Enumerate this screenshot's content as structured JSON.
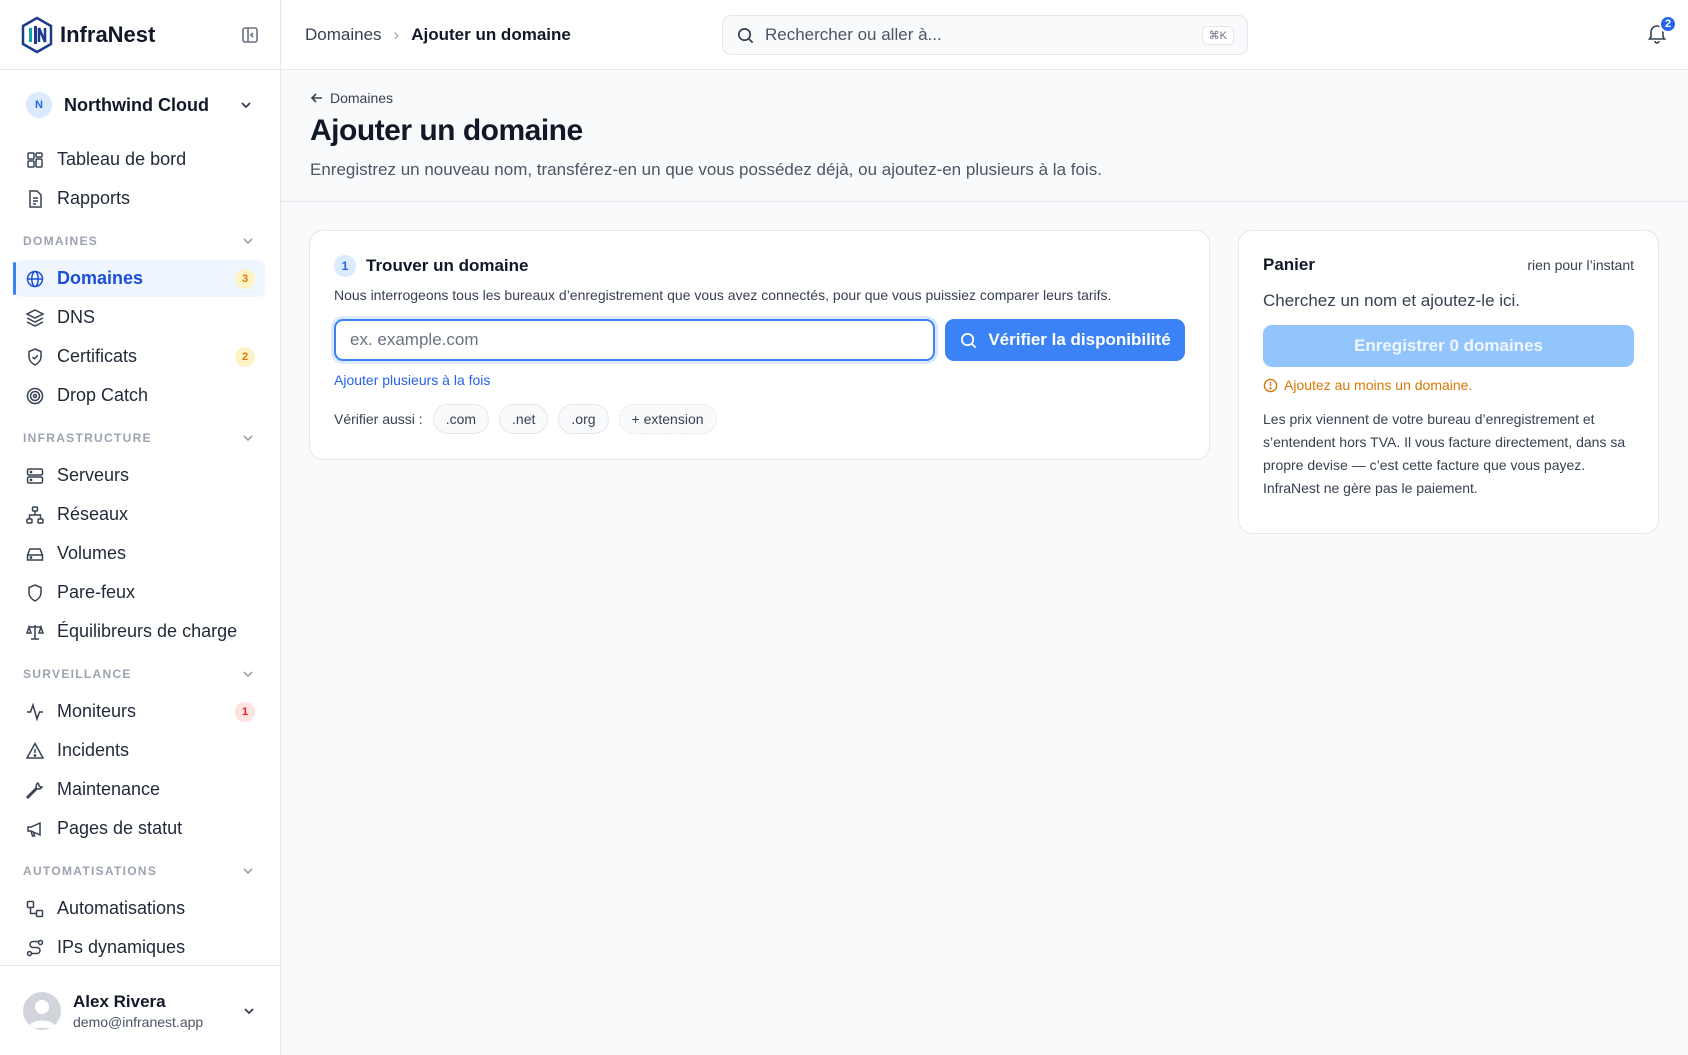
{
  "app": {
    "name": "InfraNest"
  },
  "org": {
    "initial": "N",
    "name": "Northwind Cloud"
  },
  "nav": {
    "top": [
      {
        "label": "Tableau de bord",
        "icon": "dashboard-icon"
      },
      {
        "label": "Rapports",
        "icon": "document-icon"
      }
    ],
    "sections": [
      {
        "title": "DOMAINES",
        "items": [
          {
            "label": "Domaines",
            "icon": "globe-icon",
            "badge": "3",
            "active": true
          },
          {
            "label": "DNS",
            "icon": "layers-icon"
          },
          {
            "label": "Certificats",
            "icon": "shield-check-icon",
            "badge": "2"
          },
          {
            "label": "Drop Catch",
            "icon": "target-icon"
          }
        ]
      },
      {
        "title": "INFRASTRUCTURE",
        "items": [
          {
            "label": "Serveurs",
            "icon": "server-icon"
          },
          {
            "label": "Réseaux",
            "icon": "network-icon"
          },
          {
            "label": "Volumes",
            "icon": "drive-icon"
          },
          {
            "label": "Pare-feux",
            "icon": "shield-icon"
          },
          {
            "label": "Équilibreurs de charge",
            "icon": "scale-icon"
          }
        ]
      },
      {
        "title": "SURVEILLANCE",
        "items": [
          {
            "label": "Moniteurs",
            "icon": "activity-icon",
            "badge": "1"
          },
          {
            "label": "Incidents",
            "icon": "alert-triangle-icon"
          },
          {
            "label": "Maintenance",
            "icon": "wrench-icon"
          },
          {
            "label": "Pages de statut",
            "icon": "megaphone-icon"
          }
        ]
      },
      {
        "title": "AUTOMATISATIONS",
        "items": [
          {
            "label": "Automatisations",
            "icon": "workflow-icon"
          },
          {
            "label": "IPs dynamiques",
            "icon": "route-icon"
          }
        ]
      }
    ]
  },
  "user": {
    "name": "Alex Rivera",
    "email": "demo@infranest.app"
  },
  "topbar": {
    "crumb_parent": "Domaines",
    "crumb_current": "Ajouter un domaine",
    "search_placeholder": "Rechercher ou aller à...",
    "search_shortcut": "⌘K",
    "notifications": "2"
  },
  "page": {
    "back_label": "Domaines",
    "title": "Ajouter un domaine",
    "description": "Enregistrez un nouveau nom, transférez-en un que vous possédez déjà, ou ajoutez-en plusieurs à la fois."
  },
  "find": {
    "step": "1",
    "title": "Trouver un domaine",
    "subtitle": "Nous interrogeons tous les bureaux d’enregistrement que vous avez connectés, pour que vous puissiez comparer leurs tarifs.",
    "input_placeholder": "ex. example.com",
    "check_button": "Vérifier la disponibilité",
    "bulk_link": "Ajouter plusieurs à la fois",
    "also_label": "Vérifier aussi :",
    "extensions": [
      ".com",
      ".net",
      ".org"
    ],
    "add_extension": "+ extension"
  },
  "cart": {
    "title": "Panier",
    "status": "rien pour l’instant",
    "empty": "Cherchez un nom et ajoutez-le ici.",
    "register_button": "Enregistrer 0 domaines",
    "warning": "Ajoutez au moins un domaine.",
    "note": "Les prix viennent de votre bureau d’enregistrement et s’entendent hors TVA. Il vous facture directement, dans sa propre devise — c’est cette facture que vous payez. InfraNest ne gère pas le paiement."
  },
  "colors": {
    "accent": "#3b82f6",
    "warning": "#d97706",
    "badge_amber": "#fef3c7",
    "badge_red": "#fee2e2"
  }
}
